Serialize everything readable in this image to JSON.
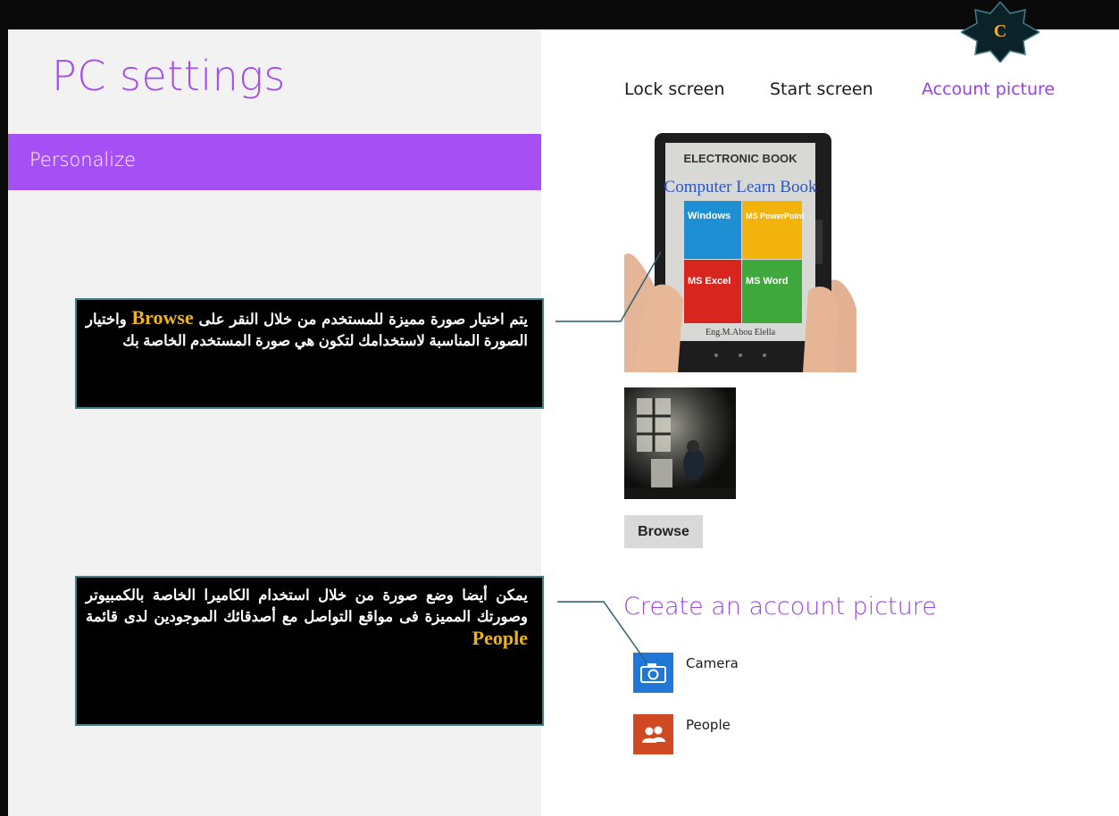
{
  "page": {
    "title": "PC settings",
    "category": "Personalize",
    "tabs": [
      {
        "label": "Lock screen",
        "active": false
      },
      {
        "label": "Start screen",
        "active": false
      },
      {
        "label": "Account picture",
        "active": true
      }
    ],
    "badge_letter": "C"
  },
  "account_picture": {
    "ebook": {
      "header": "ELECTRONIC BOOK",
      "subtitle": "Computer Learn Book",
      "tiles": [
        "Windows",
        "MS PowerPoint",
        "MS Excel",
        "MS Word"
      ],
      "author": "Eng.M.Abou Elella"
    },
    "browse_label": "Browse"
  },
  "create": {
    "heading": "Create an account picture",
    "apps": [
      {
        "label": "Camera",
        "icon": "camera-icon"
      },
      {
        "label": "People",
        "icon": "people-icon"
      }
    ]
  },
  "callouts": {
    "first": {
      "before": "يتم اختيار صورة مميزة للمستخدم من خلال النقر على ",
      "highlight": "Browse",
      "after": " واختيار الصورة المناسبة لاستخدامك لتكون هي صورة المستخدم الخاصة بك"
    },
    "second": {
      "before": "يمكن أيضا وضع صورة من خلال استخدام الكاميرا الخاصة بالكمبيوتر وصورتك المميزة فى مواقع التواصل مع أصدقائك الموجودين لدى قائمة ",
      "highlight": "People",
      "after": ""
    }
  },
  "colors": {
    "accent": "#a64ff5",
    "title": "#a24bf0",
    "active_tab": "#9a3fe8",
    "callout_bg": "#000000",
    "callout_border": "#3e7f8c",
    "highlight": "#f0b21a",
    "camera_tile": "#1f78d8",
    "people_tile": "#cf4a22"
  }
}
